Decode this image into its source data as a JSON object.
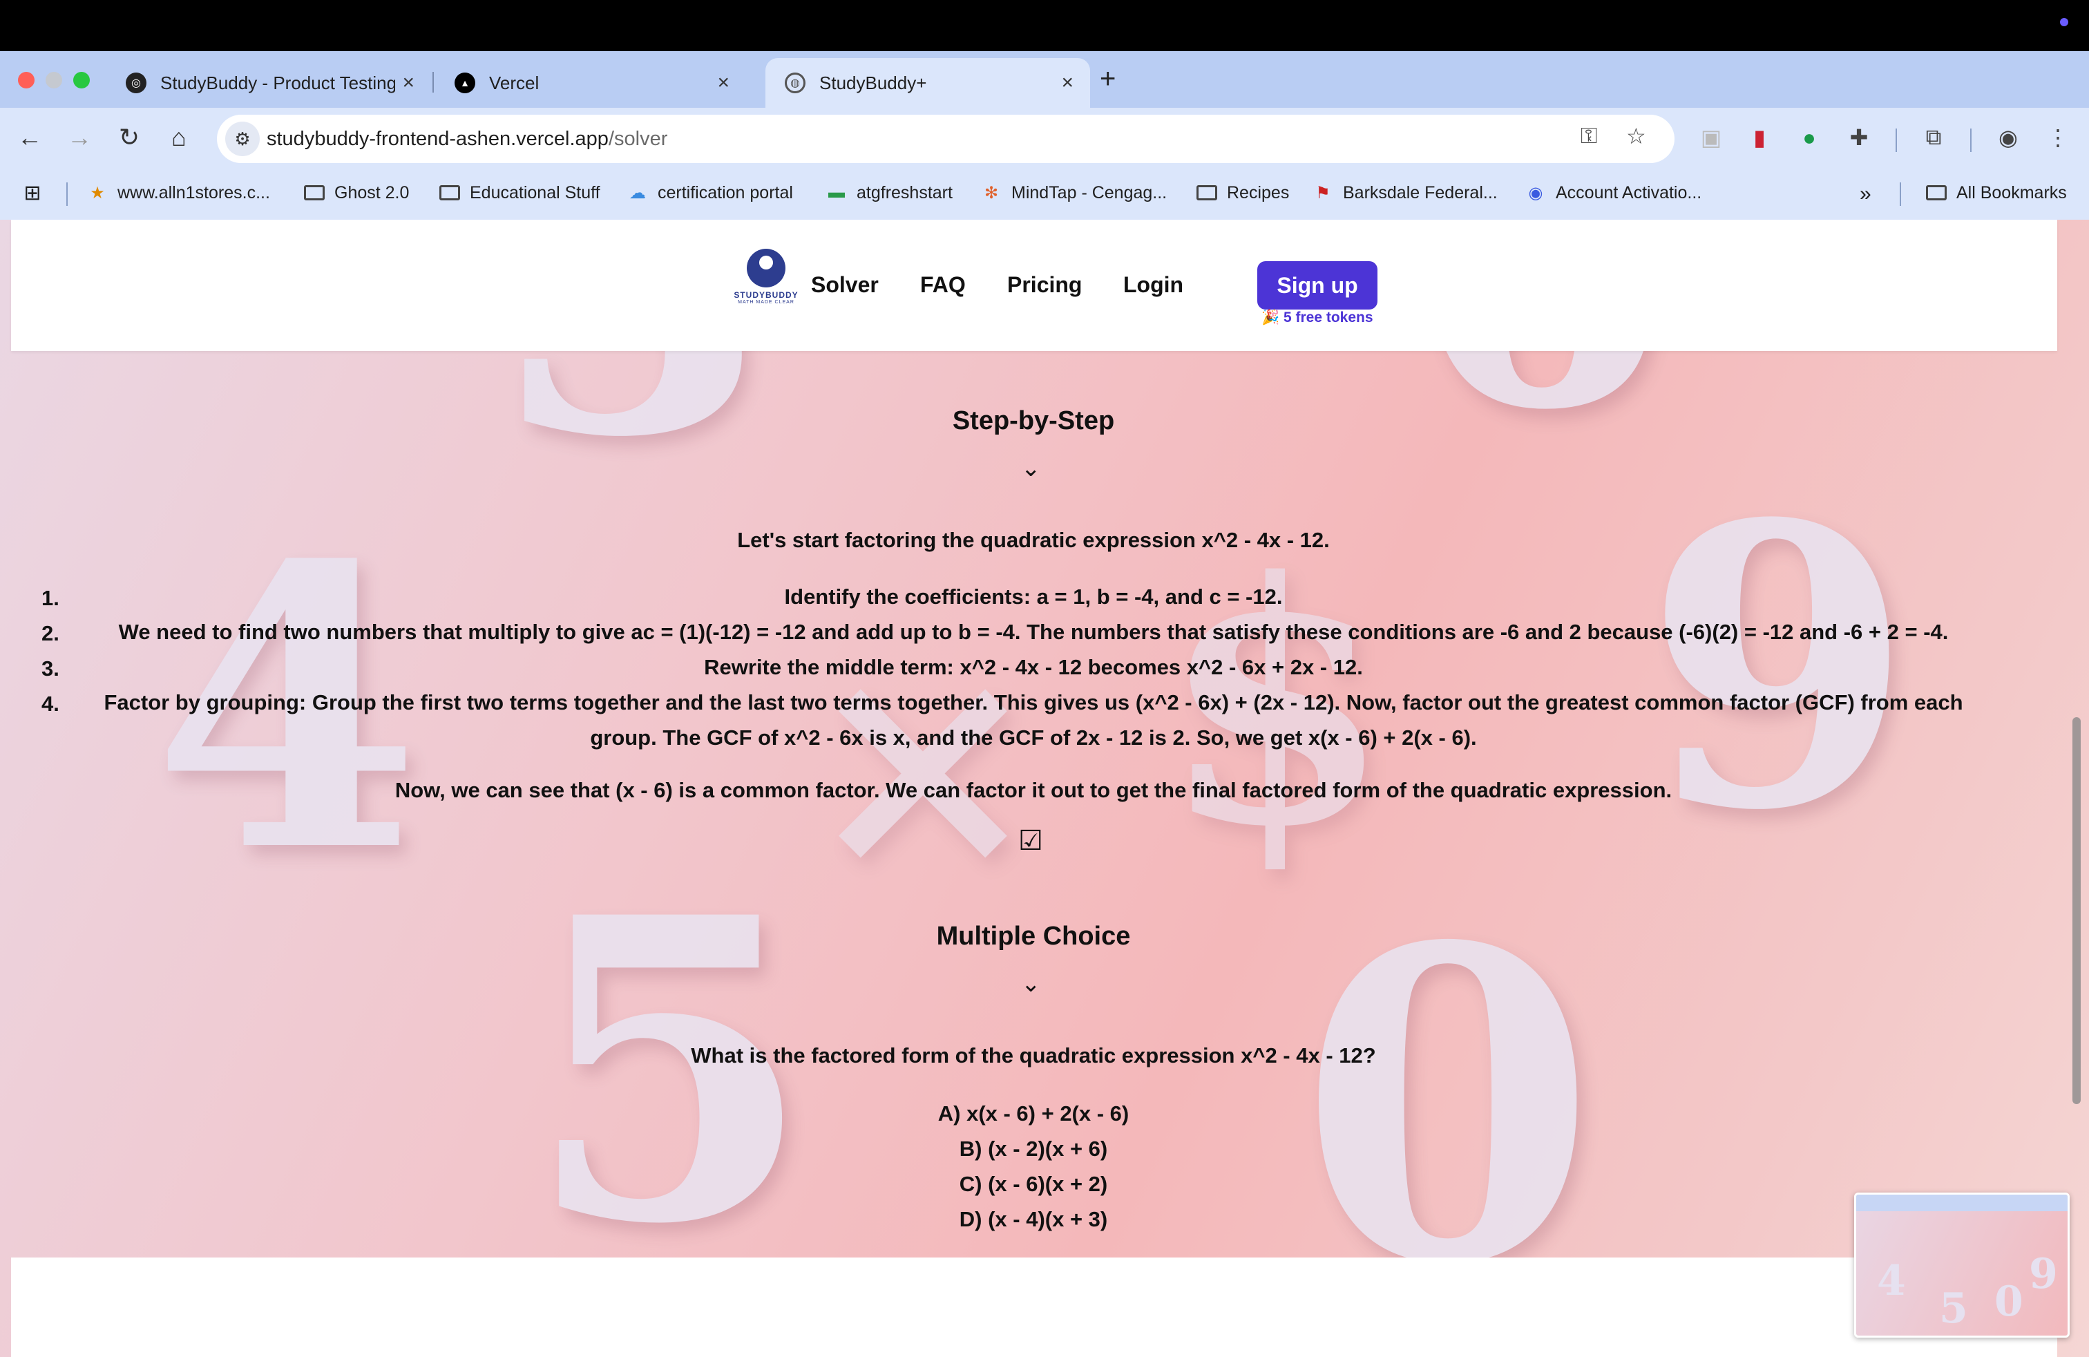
{
  "browser": {
    "tabs": [
      {
        "title": "StudyBuddy - Product Testing",
        "active": false
      },
      {
        "title": "Vercel",
        "active": false
      },
      {
        "title": "StudyBuddy+",
        "active": true
      }
    ],
    "url_host": "studybuddy-frontend-ashen.vercel.app",
    "url_path": "/solver",
    "bookmarks": [
      "www.alln1stores.c...",
      "Ghost 2.0",
      "Educational Stuff",
      "certification portal",
      "atgfreshstart",
      "MindTap - Cengag...",
      "Recipes",
      "Barksdale Federal...",
      "Account Activatio..."
    ],
    "all_bookmarks": "All Bookmarks",
    "overflow": "»"
  },
  "site": {
    "logo_text": "STUDYBUDDY",
    "logo_subtext": "MATH MADE CLEAR",
    "nav": [
      "Solver",
      "FAQ",
      "Pricing",
      "Login"
    ],
    "signup": "Sign up",
    "tokens": "🎉 5 free tokens"
  },
  "step_by_step": {
    "heading": "Step-by-Step",
    "intro": "Let's start factoring the quadratic expression x^2 - 4x - 12.",
    "steps": [
      {
        "num": "1.",
        "text": "Identify the coefficients: a = 1, b = -4, and c = -12."
      },
      {
        "num": "2.",
        "text": "We need to find two numbers that multiply to give ac = (1)(-12) = -12 and add up to b = -4. The numbers that satisfy these conditions are -6 and 2 because (-6)(2) = -12 and -6 + 2 = -4."
      },
      {
        "num": "3.",
        "text": "Rewrite the middle term: x^2 - 4x - 12 becomes x^2 - 6x + 2x - 12."
      },
      {
        "num": "4.",
        "text": "Factor by grouping: Group the first two terms together and the last two terms together. This gives us (x^2 - 6x) + (2x - 12). Now, factor out the greatest common factor (GCF) from each group. The GCF of x^2 - 6x is x, and the GCF of 2x - 12 is 2. So, we get x(x - 6) + 2(x - 6)."
      }
    ],
    "conclusion": "Now, we can see that (x - 6) is a common factor. We can factor it out to get the final factored form of the quadratic expression."
  },
  "multiple_choice": {
    "heading": "Multiple Choice",
    "question": "What is the factored form of the quadratic expression x^2 - 4x - 12?",
    "options": [
      "A) x(x - 6) + 2(x - 6)",
      "B) (x - 2)(x + 6)",
      "C) (x - 6)(x + 2)",
      "D) (x - 4)(x + 3)"
    ]
  },
  "colors": {
    "accent": "#4c34d6",
    "tab_strip": "#b9cdf3"
  }
}
